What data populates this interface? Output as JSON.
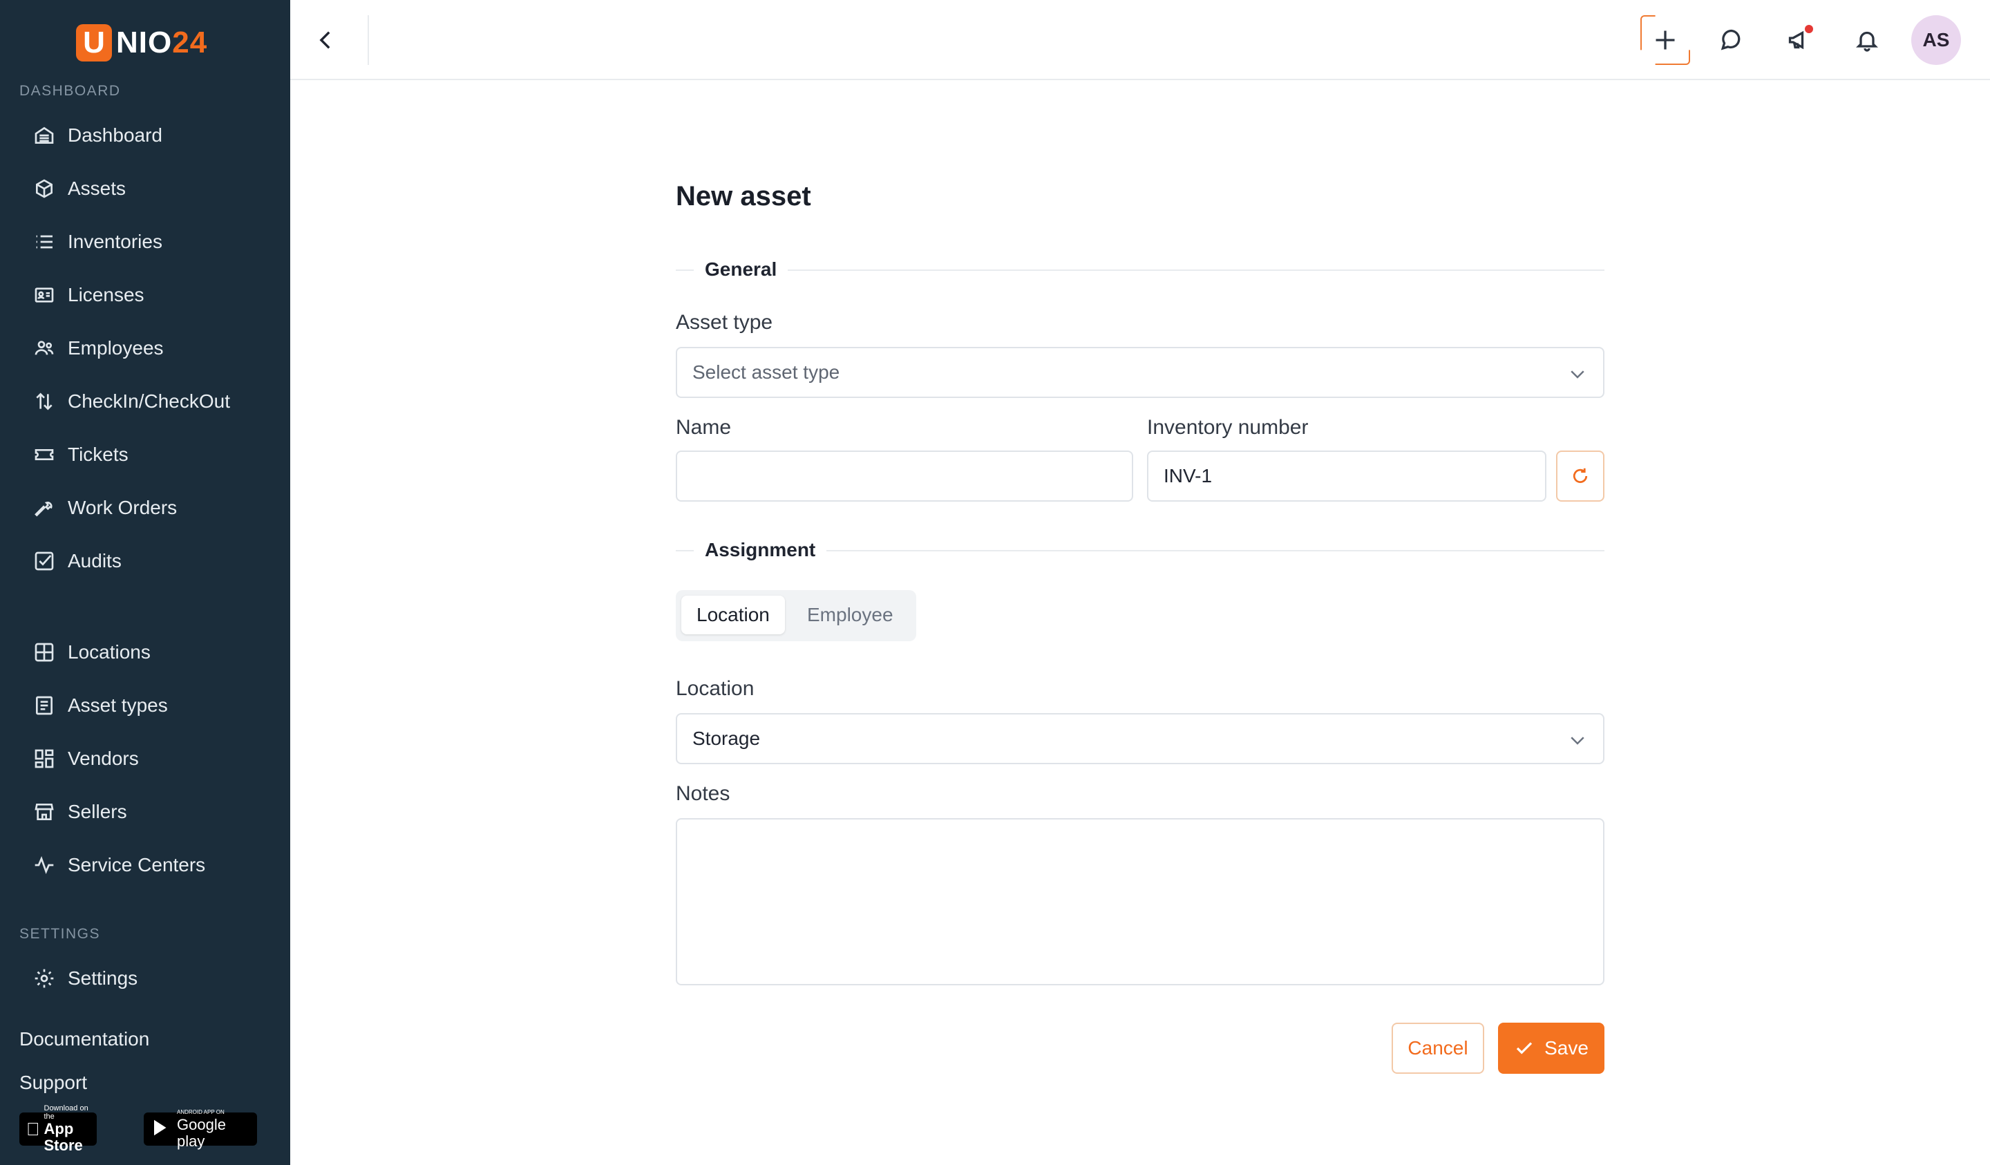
{
  "brand": {
    "logo_letter": "U",
    "logo_text": "NIO",
    "logo_num": "24",
    "accent": "#f26b1d"
  },
  "sidebar": {
    "section_dashboard": "DASHBOARD",
    "items_main": [
      {
        "label": "Dashboard",
        "icon": "dashboard-icon"
      },
      {
        "label": "Assets",
        "icon": "box-icon"
      },
      {
        "label": "Inventories",
        "icon": "list-icon"
      },
      {
        "label": "Licenses",
        "icon": "id-card-icon"
      },
      {
        "label": "Employees",
        "icon": "people-icon"
      },
      {
        "label": "CheckIn/CheckOut",
        "icon": "arrows-updown-icon"
      },
      {
        "label": "Tickets",
        "icon": "ticket-icon"
      },
      {
        "label": "Work Orders",
        "icon": "wrench-icon"
      },
      {
        "label": "Audits",
        "icon": "check-square-icon"
      }
    ],
    "items_secondary": [
      {
        "label": "Locations",
        "icon": "grid-icon"
      },
      {
        "label": "Asset types",
        "icon": "document-icon"
      },
      {
        "label": "Vendors",
        "icon": "apps-icon"
      },
      {
        "label": "Sellers",
        "icon": "store-icon"
      },
      {
        "label": "Service Centers",
        "icon": "activity-icon"
      }
    ],
    "section_settings": "SETTINGS",
    "settings_label": "Settings",
    "documentation": "Documentation",
    "support": "Support",
    "appstore_small": "Download on the",
    "appstore_big": "App Store",
    "googleplay_small": "ANDROID APP ON",
    "googleplay_big": "Google play"
  },
  "topbar": {
    "avatar_initials": "AS",
    "icons": [
      "chevron-left-icon",
      "plus-icon",
      "chat-icon",
      "megaphone-icon",
      "bell-icon"
    ]
  },
  "form": {
    "title": "New asset",
    "general_legend": "General",
    "asset_type_label": "Asset type",
    "asset_type_placeholder": "Select asset type",
    "name_label": "Name",
    "name_value": "",
    "inventory_label": "Inventory number",
    "inventory_value": "INV-1",
    "assignment_legend": "Assignment",
    "assign_tab_location": "Location",
    "assign_tab_employee": "Employee",
    "assign_selected": "Location",
    "location_label": "Location",
    "location_value": "Storage",
    "notes_label": "Notes",
    "notes_value": "",
    "cancel_label": "Cancel",
    "save_label": "Save"
  }
}
